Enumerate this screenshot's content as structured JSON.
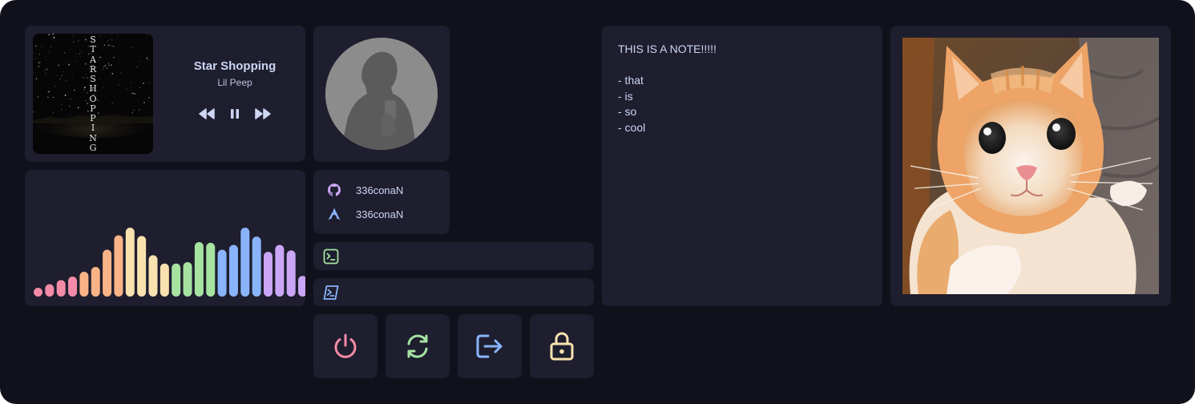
{
  "music": {
    "cover_text": [
      "S",
      "T",
      "A",
      "R",
      "S",
      "H",
      "O",
      "P",
      "P",
      "I",
      "N",
      "G"
    ],
    "title": "Star Shopping",
    "artist": "Lil Peep",
    "controls": [
      "previous-icon",
      "pause-icon",
      "next-icon"
    ]
  },
  "visualizer": {
    "levels": [
      0.12,
      0.18,
      0.24,
      0.29,
      0.36,
      0.43,
      0.68,
      0.89,
      1.0,
      0.88,
      0.6,
      0.48,
      0.48,
      0.5,
      0.79,
      0.78,
      0.68,
      0.75,
      1.0,
      0.87,
      0.65,
      0.75,
      0.67,
      0.3
    ],
    "colors": [
      "#f38ba8",
      "#f38ba8",
      "#f38ba8",
      "#f38ba8",
      "#fab387",
      "#fab387",
      "#fab387",
      "#fab387",
      "#f9e2af",
      "#f9e2af",
      "#f9e2af",
      "#f9e2af",
      "#a6e3a1",
      "#a6e3a1",
      "#a6e3a1",
      "#a6e3a1",
      "#89b4fa",
      "#89b4fa",
      "#89b4fa",
      "#89b4fa",
      "#cba6f7",
      "#cba6f7",
      "#cba6f7",
      "#cba6f7"
    ]
  },
  "socials": [
    {
      "icon": "github-icon",
      "handle": "336conaN",
      "color": "#cba6f7"
    },
    {
      "icon": "arch-icon",
      "handle": "336conaN",
      "color": "#89b4fa"
    }
  ],
  "terminals": [
    {
      "icon": "terminal-icon",
      "color": "#a6e3a1"
    },
    {
      "icon": "powershell-icon",
      "color": "#89b4fa"
    }
  ],
  "power": [
    {
      "icon": "power-icon",
      "color": "#f38ba8"
    },
    {
      "icon": "refresh-icon",
      "color": "#a6e3a1"
    },
    {
      "icon": "logout-icon",
      "color": "#89b4fa"
    },
    {
      "icon": "lock-icon",
      "color": "#f9e2af"
    }
  ],
  "note": {
    "lines": [
      "THIS IS A NOTE!!!!!",
      "",
      "- that",
      "- is",
      "- so",
      "- cool"
    ]
  },
  "colors": {
    "background": "#11111b",
    "surface": "#1e1e2e",
    "text": "#cdd6f4"
  }
}
